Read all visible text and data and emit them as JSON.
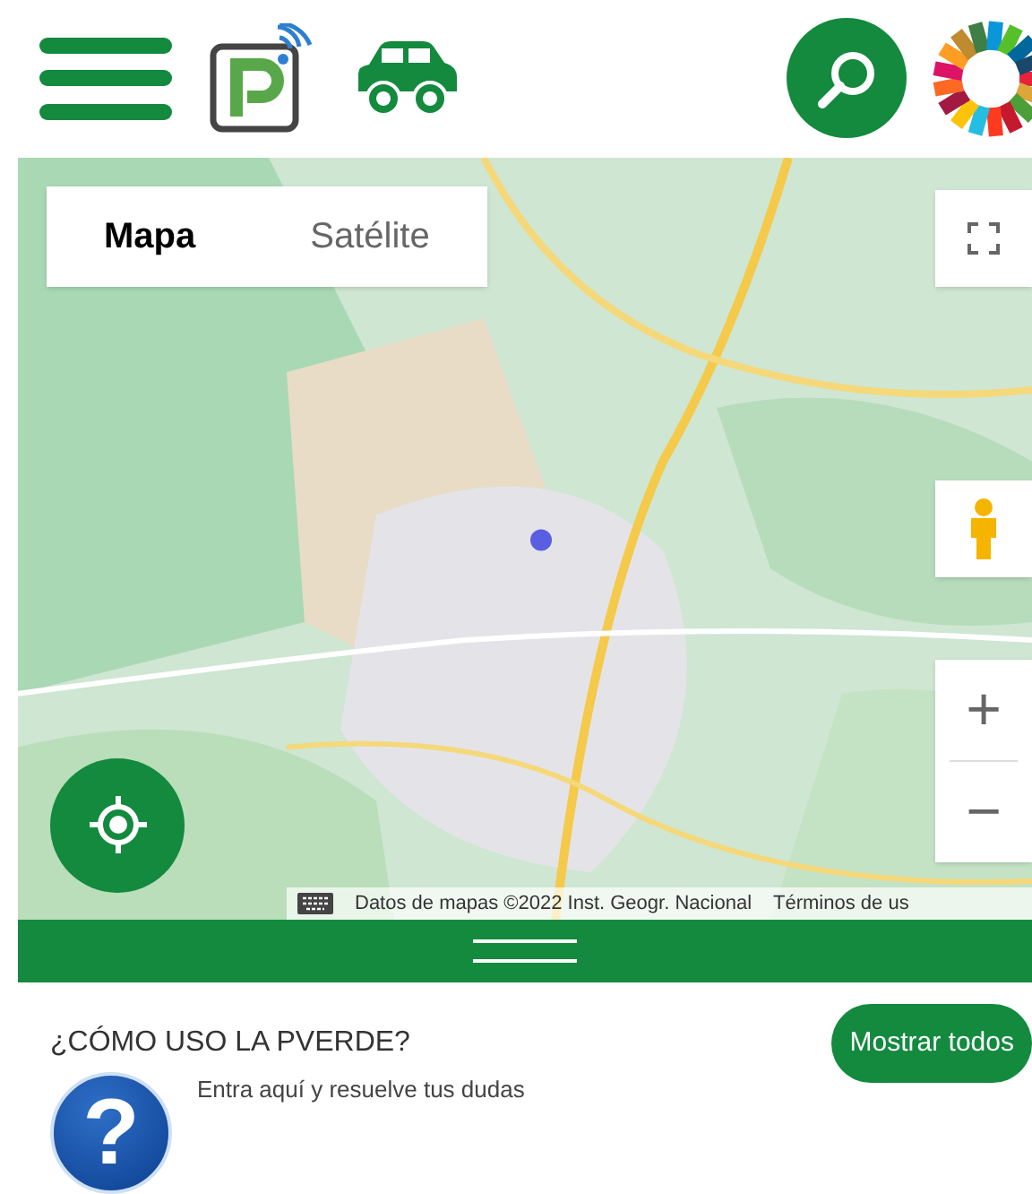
{
  "map": {
    "map_type_tabs": [
      {
        "label": "Mapa",
        "selected": true
      },
      {
        "label": "Satélite",
        "selected": false
      }
    ],
    "zoom_in": "+",
    "zoom_out": "−",
    "attribution": "Datos de mapas ©2022 Inst. Geogr. Nacional",
    "terms": "Términos de us"
  },
  "help": {
    "title": "¿CÓMO USO LA PVERDE?",
    "show_all_button": "Mostrar todos",
    "icon_glyph": "?",
    "text": "Entra aquí y resuelve tus dudas"
  }
}
